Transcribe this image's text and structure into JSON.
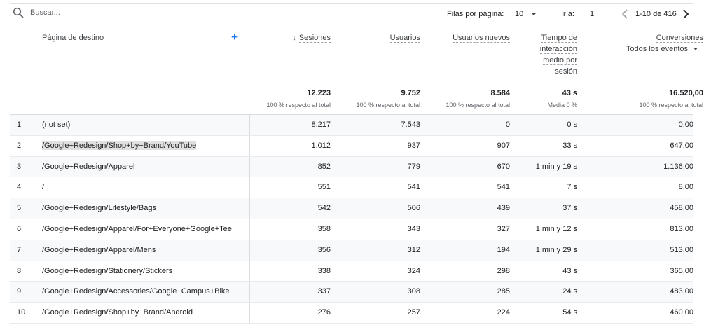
{
  "toolbar": {
    "search_placeholder": "Buscar...",
    "rows_per_page_label": "Filas por página:",
    "rows_per_page_value": "10",
    "goto_label": "Ir a:",
    "goto_value": "1",
    "range": "1-10 de 416"
  },
  "table": {
    "dimension_header": "Página de destino",
    "columns": [
      {
        "label_lines": [
          "Sesiones"
        ],
        "total": "12.223",
        "pct": "100 % respecto al total",
        "sorted": true
      },
      {
        "label_lines": [
          "Usuarios"
        ],
        "total": "9.752",
        "pct": "100 % respecto al total"
      },
      {
        "label_lines": [
          "Usuarios nuevos"
        ],
        "total": "8.584",
        "pct": "100 % respecto al total"
      },
      {
        "label_lines": [
          "Tiempo de",
          "interacción",
          "medio por",
          "sesión"
        ],
        "total": "43 s",
        "pct": "Media 0 %"
      },
      {
        "label_lines": [
          "Conversiones"
        ],
        "sub": "Todos los eventos",
        "total": "16.520,00",
        "pct": "100 % respecto al total"
      }
    ],
    "rows": [
      {
        "idx": "1",
        "page": "(not set)",
        "sessions": "8.217",
        "users": "7.543",
        "new_users": "0",
        "time": "0 s",
        "conv": "0,00"
      },
      {
        "idx": "2",
        "page": "/Google+Redesign/Shop+by+Brand/YouTube",
        "sessions": "1.012",
        "users": "937",
        "new_users": "907",
        "time": "33 s",
        "conv": "647,00"
      },
      {
        "idx": "3",
        "page": "/Google+Redesign/Apparel",
        "sessions": "852",
        "users": "779",
        "new_users": "670",
        "time": "1 min y 19 s",
        "conv": "1.136,00"
      },
      {
        "idx": "4",
        "page": "/",
        "sessions": "551",
        "users": "541",
        "new_users": "541",
        "time": "7 s",
        "conv": "8,00"
      },
      {
        "idx": "5",
        "page": "/Google+Redesign/Lifestyle/Bags",
        "sessions": "542",
        "users": "506",
        "new_users": "439",
        "time": "37 s",
        "conv": "458,00"
      },
      {
        "idx": "6",
        "page": "/Google+Redesign/Apparel/For+Everyone+Google+Tee",
        "sessions": "358",
        "users": "343",
        "new_users": "327",
        "time": "1 min y 12 s",
        "conv": "813,00"
      },
      {
        "idx": "7",
        "page": "/Google+Redesign/Apparel/Mens",
        "sessions": "356",
        "users": "312",
        "new_users": "194",
        "time": "1 min y 29 s",
        "conv": "513,00"
      },
      {
        "idx": "8",
        "page": "/Google+Redesign/Stationery/Stickers",
        "sessions": "338",
        "users": "324",
        "new_users": "298",
        "time": "43 s",
        "conv": "365,00"
      },
      {
        "idx": "9",
        "page": "/Google+Redesign/Accessories/Google+Campus+Bike",
        "sessions": "337",
        "users": "308",
        "new_users": "285",
        "time": "24 s",
        "conv": "483,00"
      },
      {
        "idx": "10",
        "page": "/Google+Redesign/Shop+by+Brand/Android",
        "sessions": "276",
        "users": "257",
        "new_users": "224",
        "time": "54 s",
        "conv": "460,00"
      }
    ]
  }
}
